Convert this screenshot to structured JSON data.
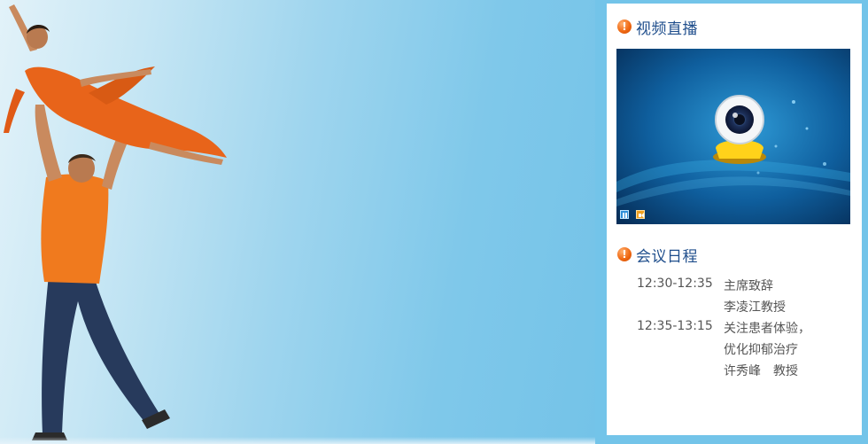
{
  "video_section": {
    "title": "视频直播"
  },
  "agenda_section": {
    "title": "会议日程"
  },
  "agenda": [
    {
      "time": "12:30-12:35",
      "lines": [
        "主席致辞",
        "李凌江教授"
      ]
    },
    {
      "time": "12:35-13:15",
      "lines": [
        "关注患者体验，",
        "优化抑郁治疗",
        "许秀峰　教授"
      ]
    }
  ],
  "icons": {
    "section_marker": "exclamation-circle-icon",
    "video_placeholder": "webcam-icon",
    "pause": "pause-icon",
    "volume": "volume-icon"
  },
  "colors": {
    "frame_blue": "#73c4e9",
    "title_blue": "#1f4e8c",
    "alert_orange": "#f06a14",
    "text_gray": "#555555"
  }
}
